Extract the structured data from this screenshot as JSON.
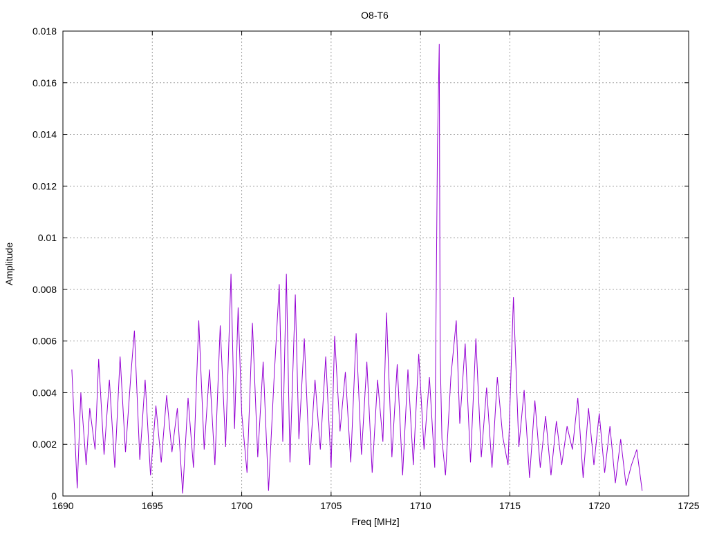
{
  "chart_data": {
    "type": "line",
    "title": "O8-T6",
    "xlabel": "Freq [MHz]",
    "ylabel": "Amplitude",
    "xlim": [
      1690,
      1725
    ],
    "ylim": [
      0,
      0.018
    ],
    "xticks": [
      1690,
      1695,
      1700,
      1705,
      1710,
      1715,
      1720,
      1725
    ],
    "yticks": [
      0,
      0.002,
      0.004,
      0.006,
      0.008,
      0.01,
      0.012,
      0.014,
      0.016,
      0.018
    ],
    "xtick_labels": [
      "1690",
      "1695",
      "1700",
      "1705",
      "1710",
      "1715",
      "1720",
      "1725"
    ],
    "ytick_labels": [
      "0",
      "0.002",
      "0.004",
      "0.006",
      "0.008",
      "0.01",
      "0.012",
      "0.014",
      "0.016",
      "0.018"
    ],
    "grid": true,
    "series": [
      {
        "color": "#9400d3",
        "x": [
          1690.5,
          1690.8,
          1691.0,
          1691.3,
          1691.5,
          1691.8,
          1692.0,
          1692.3,
          1692.6,
          1692.9,
          1693.2,
          1693.5,
          1693.8,
          1694.0,
          1694.3,
          1694.6,
          1694.9,
          1695.2,
          1695.5,
          1695.8,
          1696.1,
          1696.4,
          1696.7,
          1697.0,
          1697.3,
          1697.6,
          1697.9,
          1698.2,
          1698.5,
          1698.8,
          1699.1,
          1699.4,
          1699.6,
          1699.8,
          1700.0,
          1700.3,
          1700.6,
          1700.9,
          1701.2,
          1701.5,
          1701.8,
          1702.1,
          1702.3,
          1702.5,
          1702.7,
          1703.0,
          1703.2,
          1703.5,
          1703.8,
          1704.1,
          1704.4,
          1704.7,
          1705.0,
          1705.2,
          1705.5,
          1705.8,
          1706.1,
          1706.4,
          1706.7,
          1707.0,
          1707.3,
          1707.6,
          1707.9,
          1708.1,
          1708.4,
          1708.7,
          1709.0,
          1709.3,
          1709.6,
          1709.9,
          1710.2,
          1710.5,
          1710.8,
          1710.95,
          1711.05,
          1711.1,
          1711.2,
          1711.4,
          1711.7,
          1712.0,
          1712.2,
          1712.5,
          1712.8,
          1713.1,
          1713.4,
          1713.7,
          1714.0,
          1714.3,
          1714.6,
          1714.9,
          1715.2,
          1715.5,
          1715.8,
          1716.1,
          1716.4,
          1716.7,
          1717.0,
          1717.3,
          1717.6,
          1717.9,
          1718.2,
          1718.5,
          1718.8,
          1719.1,
          1719.4,
          1719.7,
          1720.0,
          1720.3,
          1720.6,
          1720.9,
          1721.2,
          1721.5,
          1721.8,
          1722.1,
          1722.4
        ],
        "y": [
          0.0049,
          0.0003,
          0.004,
          0.0012,
          0.0034,
          0.0018,
          0.0053,
          0.0016,
          0.0045,
          0.0011,
          0.0054,
          0.0017,
          0.0047,
          0.0064,
          0.0014,
          0.0045,
          0.0008,
          0.0035,
          0.0013,
          0.0039,
          0.0017,
          0.0034,
          0.0001,
          0.0038,
          0.0011,
          0.0068,
          0.0018,
          0.0049,
          0.0012,
          0.0066,
          0.0019,
          0.0086,
          0.0026,
          0.0073,
          0.0032,
          0.0009,
          0.0067,
          0.0015,
          0.0052,
          0.0002,
          0.0044,
          0.0082,
          0.0021,
          0.0086,
          0.0013,
          0.0078,
          0.0022,
          0.0061,
          0.0012,
          0.0045,
          0.0018,
          0.0054,
          0.0011,
          0.0062,
          0.0025,
          0.0048,
          0.0013,
          0.0063,
          0.0016,
          0.0052,
          0.0009,
          0.0045,
          0.0021,
          0.0071,
          0.0015,
          0.0051,
          0.0008,
          0.0049,
          0.0012,
          0.0055,
          0.0018,
          0.0046,
          0.0011,
          0.0135,
          0.0175,
          0.0055,
          0.0022,
          0.0008,
          0.0046,
          0.0068,
          0.0028,
          0.0059,
          0.0013,
          0.0061,
          0.0015,
          0.0042,
          0.0011,
          0.0046,
          0.0023,
          0.0012,
          0.0077,
          0.0019,
          0.0041,
          0.0007,
          0.0037,
          0.0011,
          0.0031,
          0.0008,
          0.0029,
          0.0012,
          0.0027,
          0.0018,
          0.0038,
          0.0007,
          0.0034,
          0.0012,
          0.0032,
          0.0009,
          0.0027,
          0.0005,
          0.0022,
          0.0004,
          0.0012,
          0.0018,
          0.0002
        ]
      }
    ]
  }
}
